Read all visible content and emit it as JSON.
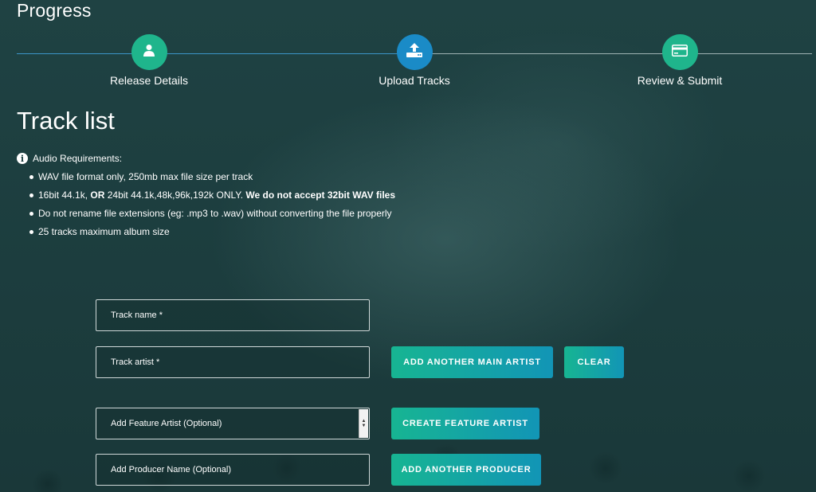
{
  "header": {
    "title": "Progress"
  },
  "stepper": {
    "steps": [
      {
        "label": "Release Details",
        "icon": "user-icon",
        "status": "completed"
      },
      {
        "label": "Upload Tracks",
        "icon": "upload-icon",
        "status": "active"
      },
      {
        "label": "Review & Submit",
        "icon": "credit-card-icon",
        "status": "pending"
      }
    ]
  },
  "main": {
    "title": "Track list",
    "requirements": {
      "heading": "Audio Requirements:",
      "items": [
        "WAV file format only, 250mb max file size per track",
        "16bit 44.1k, OR 24bit 44.1k,48k,96k,192k ONLY. We do not accept 32bit WAV files",
        "Do not rename file extensions (eg: .mp3 to .wav) without converting the file properly",
        "25 tracks maximum album size"
      ],
      "item2_parts": {
        "a": "16bit 44.1k, ",
        "b": "OR",
        "c": " 24bit 44.1k,48k,96k,192k ONLY. ",
        "d": "We do not accept 32bit WAV files"
      }
    },
    "form": {
      "track_name_placeholder": "Track name *",
      "track_artist_placeholder": "Track artist *",
      "feature_artist_selected": "Add Feature Artist (Optional)",
      "producer_placeholder": "Add Producer Name (Optional)",
      "add_main_artist_label": "ADD ANOTHER MAIN ARTIST",
      "clear_label": "CLEAR",
      "create_feature_artist_label": "CREATE FEATURE ARTIST",
      "add_producer_label": "ADD ANOTHER PRODUCER"
    }
  },
  "colors": {
    "background": "#1d3f40",
    "step_completed": "#1fb58c",
    "step_active": "#1a8bc7",
    "button_gradient_start": "#17b592",
    "button_gradient_end": "#1295b6"
  }
}
